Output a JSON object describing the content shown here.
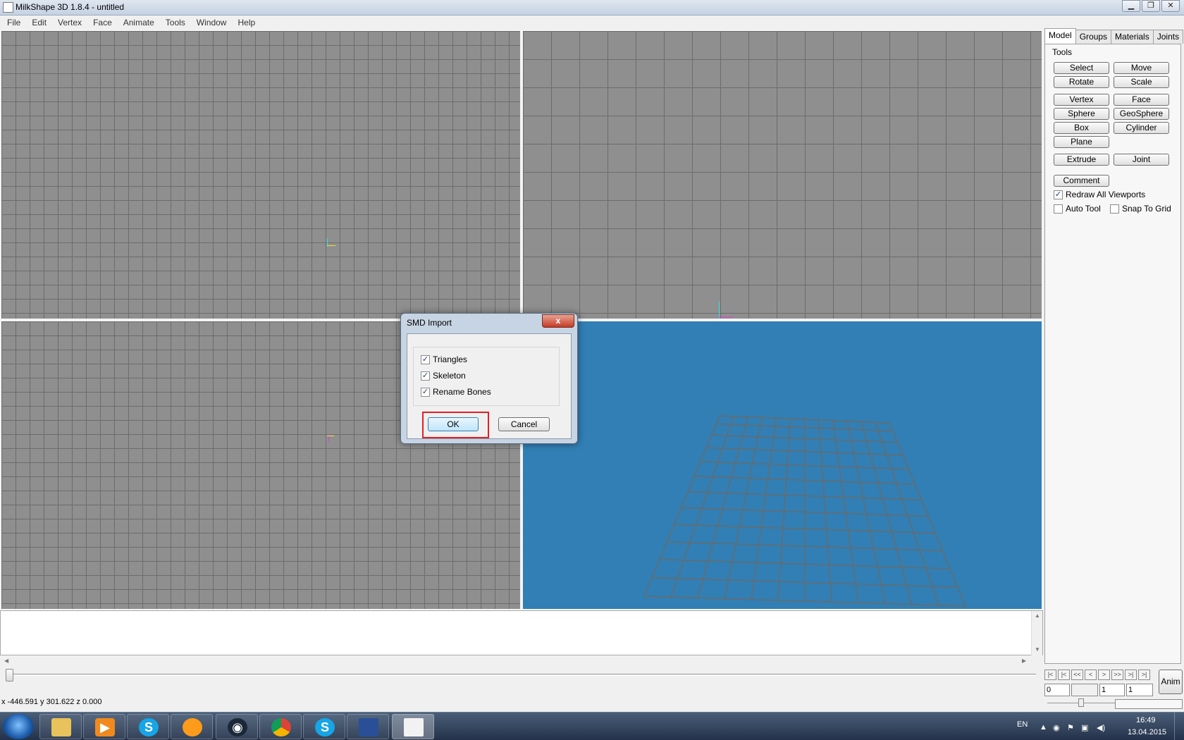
{
  "window": {
    "title": "MilkShape 3D 1.8.4 - untitled",
    "minimize": "▁",
    "maximize": "❐",
    "close": "✕"
  },
  "menu": [
    "File",
    "Edit",
    "Vertex",
    "Face",
    "Animate",
    "Tools",
    "Window",
    "Help"
  ],
  "tabs": [
    "Model",
    "Groups",
    "Materials",
    "Joints"
  ],
  "tools": {
    "group_label": "Tools",
    "select": "Select",
    "move": "Move",
    "rotate": "Rotate",
    "scale": "Scale",
    "vertex": "Vertex",
    "face": "Face",
    "sphere": "Sphere",
    "geosphere": "GeoSphere",
    "box": "Box",
    "cylinder": "Cylinder",
    "plane": "Plane",
    "extrude": "Extrude",
    "joint": "Joint",
    "comment": "Comment"
  },
  "options": {
    "redraw_all_viewports": {
      "label": "Redraw All Viewports",
      "checked": true
    },
    "auto_tool": {
      "label": "Auto Tool",
      "checked": false
    },
    "snap_to_grid": {
      "label": "Snap To Grid",
      "checked": false
    }
  },
  "status": {
    "coords": "x -446.591 y 301.622 z 0.000"
  },
  "anim": {
    "nav": [
      "|<",
      "|<",
      "<<",
      "<",
      ">",
      ">>",
      ">|",
      ">|"
    ],
    "frame_start": "0",
    "frame_current": "",
    "frame_a": "1",
    "frame_b": "1",
    "button": "Anim"
  },
  "dialog": {
    "title": "SMD Import",
    "close": "x",
    "options": [
      {
        "label": "Triangles",
        "checked": true
      },
      {
        "label": "Skeleton",
        "checked": true
      },
      {
        "label": "Rename Bones",
        "checked": true
      }
    ],
    "ok": "OK",
    "cancel": "Cancel"
  },
  "taskbar": {
    "apps": [
      "explorer",
      "media-player",
      "skype",
      "app-orange",
      "steam",
      "chrome",
      "skype",
      "paint-tool",
      "milkshape"
    ],
    "lang": "EN",
    "time": "16:49",
    "date": "13.04.2015"
  },
  "colors": {
    "viewport_grid": "#8f8f8f",
    "perspective_bg": "#317fb4",
    "highlight": "#e41e26"
  }
}
